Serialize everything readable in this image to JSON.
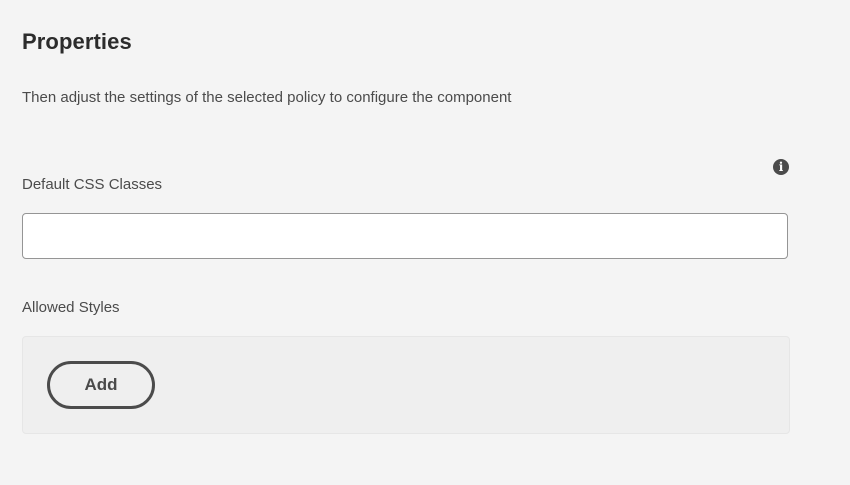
{
  "properties": {
    "title": "Properties",
    "description": "Then adjust the settings of the selected policy to configure the component",
    "info_icon_glyph": "i",
    "css_classes": {
      "label": "Default CSS Classes",
      "value": "",
      "placeholder": ""
    },
    "allowed_styles": {
      "label": "Allowed Styles",
      "add_label": "Add"
    }
  },
  "colors": {
    "background": "#f4f4f4",
    "text_primary": "#2c2c2c",
    "text_secondary": "#4b4b4b",
    "input_border": "#959595",
    "styles_box_background": "#efefef"
  },
  "icons": {
    "info": "info-icon"
  }
}
